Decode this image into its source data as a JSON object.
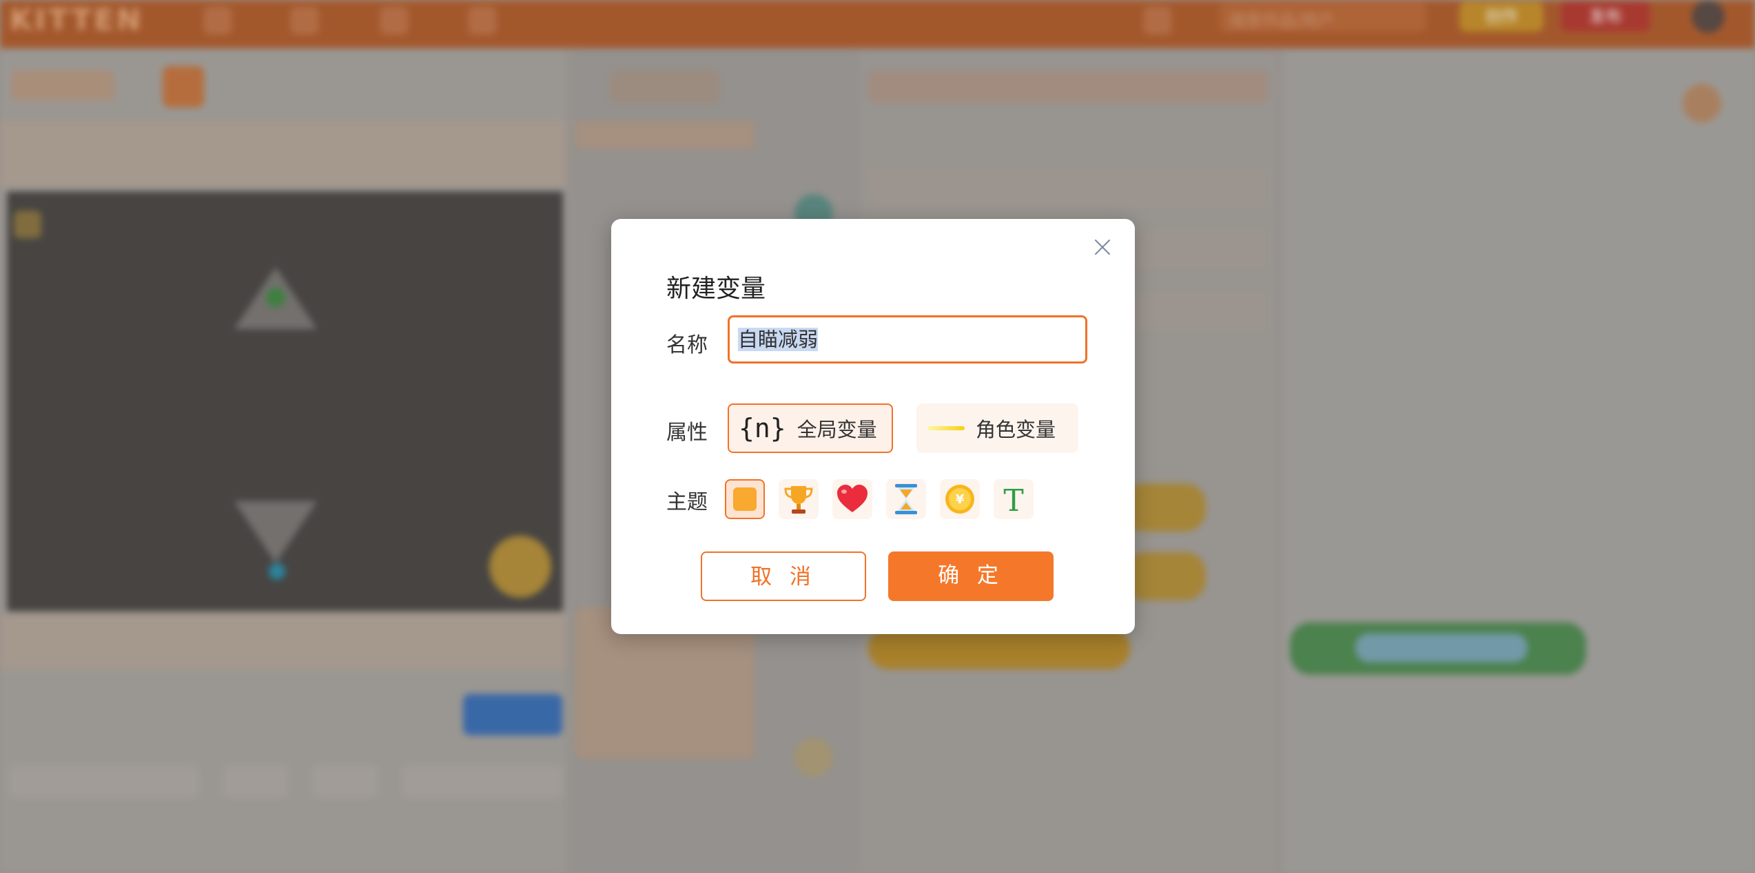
{
  "app": {
    "brand": "KITTEN",
    "search_placeholder": "搜索作品/用户",
    "btn_yellow": "创作",
    "btn_red": "发布"
  },
  "dialog": {
    "title": "新建变量",
    "name_label": "名称",
    "name_value": "自瞄减弱",
    "property_label": "属性",
    "global_option_icon": "{n}",
    "global_option": "全局变量",
    "role_option": "角色变量",
    "theme_label": "主题",
    "themes": [
      "square-icon",
      "trophy-icon",
      "heart-icon",
      "hourglass-icon",
      "coin-icon",
      "text-icon"
    ],
    "selected_theme": "square-icon",
    "selected_property": "全局变量",
    "cancel_label": "取 消",
    "ok_label": "确 定",
    "accent_color": "#f5782a"
  }
}
